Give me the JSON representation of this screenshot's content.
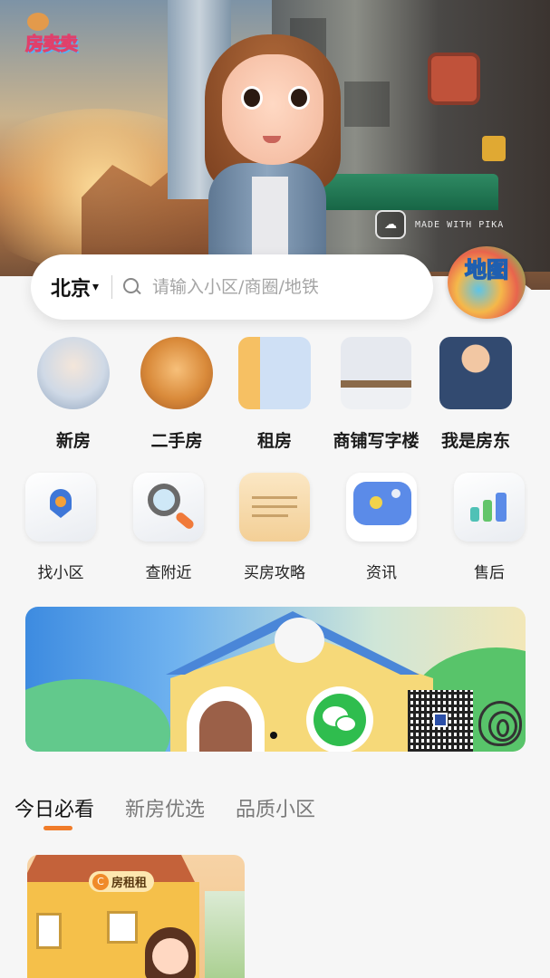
{
  "app": {
    "logo_text": "房卖卖",
    "watermark": "MADE WITH PIKA"
  },
  "search": {
    "city": "北京",
    "city_caret": "▾",
    "placeholder": "请输入小区/商圈/地铁"
  },
  "map_button": {
    "label": "地图"
  },
  "main_categories": [
    {
      "label": "新房",
      "icon": "princess-avatar-icon"
    },
    {
      "label": "二手房",
      "icon": "lion-mascot-icon"
    },
    {
      "label": "租房",
      "icon": "building-icon"
    },
    {
      "label": "商铺写字楼",
      "icon": "office-desk-icon"
    },
    {
      "label": "我是房东",
      "icon": "landlord-avatar-icon"
    }
  ],
  "secondary_categories": [
    {
      "label": "找小区",
      "icon": "location-pin-icon"
    },
    {
      "label": "查附近",
      "icon": "magnifier-icon"
    },
    {
      "label": "买房攻略",
      "icon": "notepad-icon"
    },
    {
      "label": "资讯",
      "icon": "camera-chat-icon"
    },
    {
      "label": "售后",
      "icon": "bar-chart-icon"
    }
  ],
  "banner": {
    "icons": [
      "wechat-icon",
      "qr-code",
      "fingerprint-icon"
    ],
    "active_dot": 1
  },
  "tabs": [
    {
      "label": "今日必看",
      "active": true
    },
    {
      "label": "新房优选",
      "active": false
    },
    {
      "label": "品质小区",
      "active": false
    }
  ],
  "card": {
    "badge_text": "房租租",
    "badge_icon_text": "C"
  },
  "colors": {
    "accent": "#f07c2a",
    "text_primary": "#111111",
    "text_secondary": "#7a7a7a",
    "background": "#f6f6f6"
  }
}
